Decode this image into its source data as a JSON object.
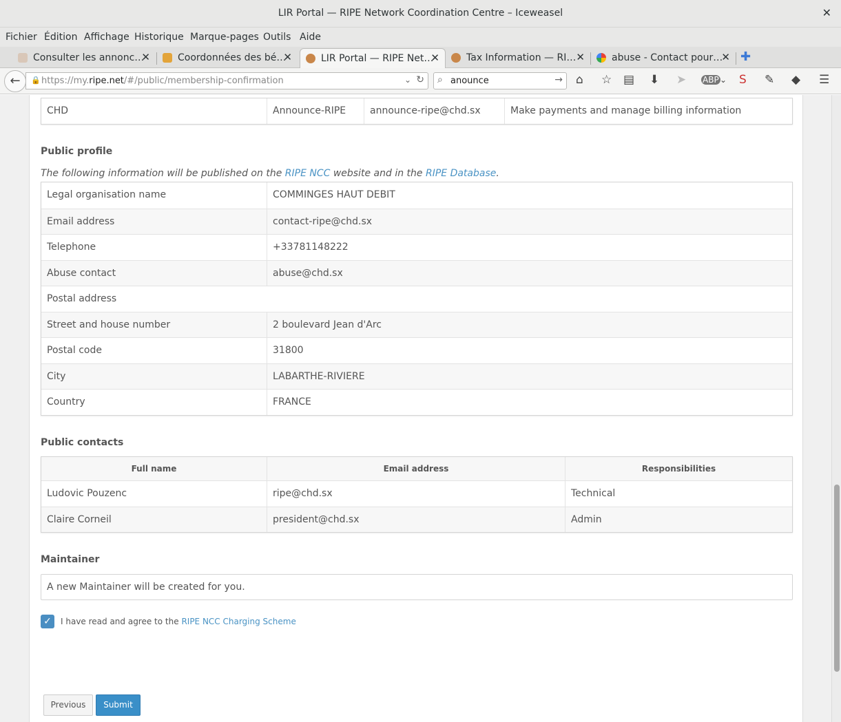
{
  "window": {
    "title": "LIR Portal — RIPE Network Coordination Centre – Iceweasel"
  },
  "menu": [
    "Fichier",
    "Édition",
    "Affichage",
    "Historique",
    "Marque-pages",
    "Outils",
    "Aide"
  ],
  "tabs": [
    {
      "label": "Consulter les annonc…"
    },
    {
      "label": "Coordonnées des bé…"
    },
    {
      "label": "LIR Portal — RIPE Net…"
    },
    {
      "label": "Tax Information — RI…"
    },
    {
      "label": "abuse - Contact pour…"
    }
  ],
  "nav": {
    "url_prefix": "https://my.",
    "url_domain": "ripe.net",
    "url_path": "/#/public/membership-confirmation",
    "search_value": "anounce"
  },
  "billing_row": {
    "org": "CHD",
    "name": "Announce-RIPE",
    "email": "announce-ripe@chd.sx",
    "responsibility": "Make payments and manage billing information"
  },
  "public_profile": {
    "title": "Public profile",
    "intro_start": "The following information will be published on the ",
    "intro_link1": "RIPE NCC",
    "intro_mid": " website and in the ",
    "intro_link2": "RIPE Database",
    "intro_end": ".",
    "rows": [
      {
        "label": "Legal organisation name",
        "value": "COMMINGES HAUT DEBIT"
      },
      {
        "label": "Email address",
        "value": "contact-ripe@chd.sx"
      },
      {
        "label": "Telephone",
        "value": "+33781148222"
      },
      {
        "label": "Abuse contact",
        "value": "abuse@chd.sx"
      },
      {
        "label": "Postal address",
        "value": ""
      },
      {
        "label": "Street and house number",
        "value": "2 boulevard Jean d'Arc"
      },
      {
        "label": "Postal code",
        "value": "31800"
      },
      {
        "label": "City",
        "value": "LABARTHE-RIVIERE"
      },
      {
        "label": "Country",
        "value": "FRANCE"
      }
    ]
  },
  "public_contacts": {
    "title": "Public contacts",
    "headers": [
      "Full name",
      "Email address",
      "Responsibilities"
    ],
    "rows": [
      {
        "name": "Ludovic Pouzenc",
        "email": "ripe@chd.sx",
        "role": "Technical"
      },
      {
        "name": "Claire Corneil",
        "email": "president@chd.sx",
        "role": "Admin"
      }
    ]
  },
  "maintainer": {
    "title": "Maintainer",
    "text": "A new Maintainer will be created for you."
  },
  "agreement": {
    "text": "I have read and agree to the ",
    "link": "RIPE NCC Charging Scheme",
    "checked": true
  },
  "buttons": {
    "previous": "Previous",
    "submit": "Submit"
  },
  "colors": {
    "accent": "#3a8fc8",
    "link": "#4a93c4"
  }
}
